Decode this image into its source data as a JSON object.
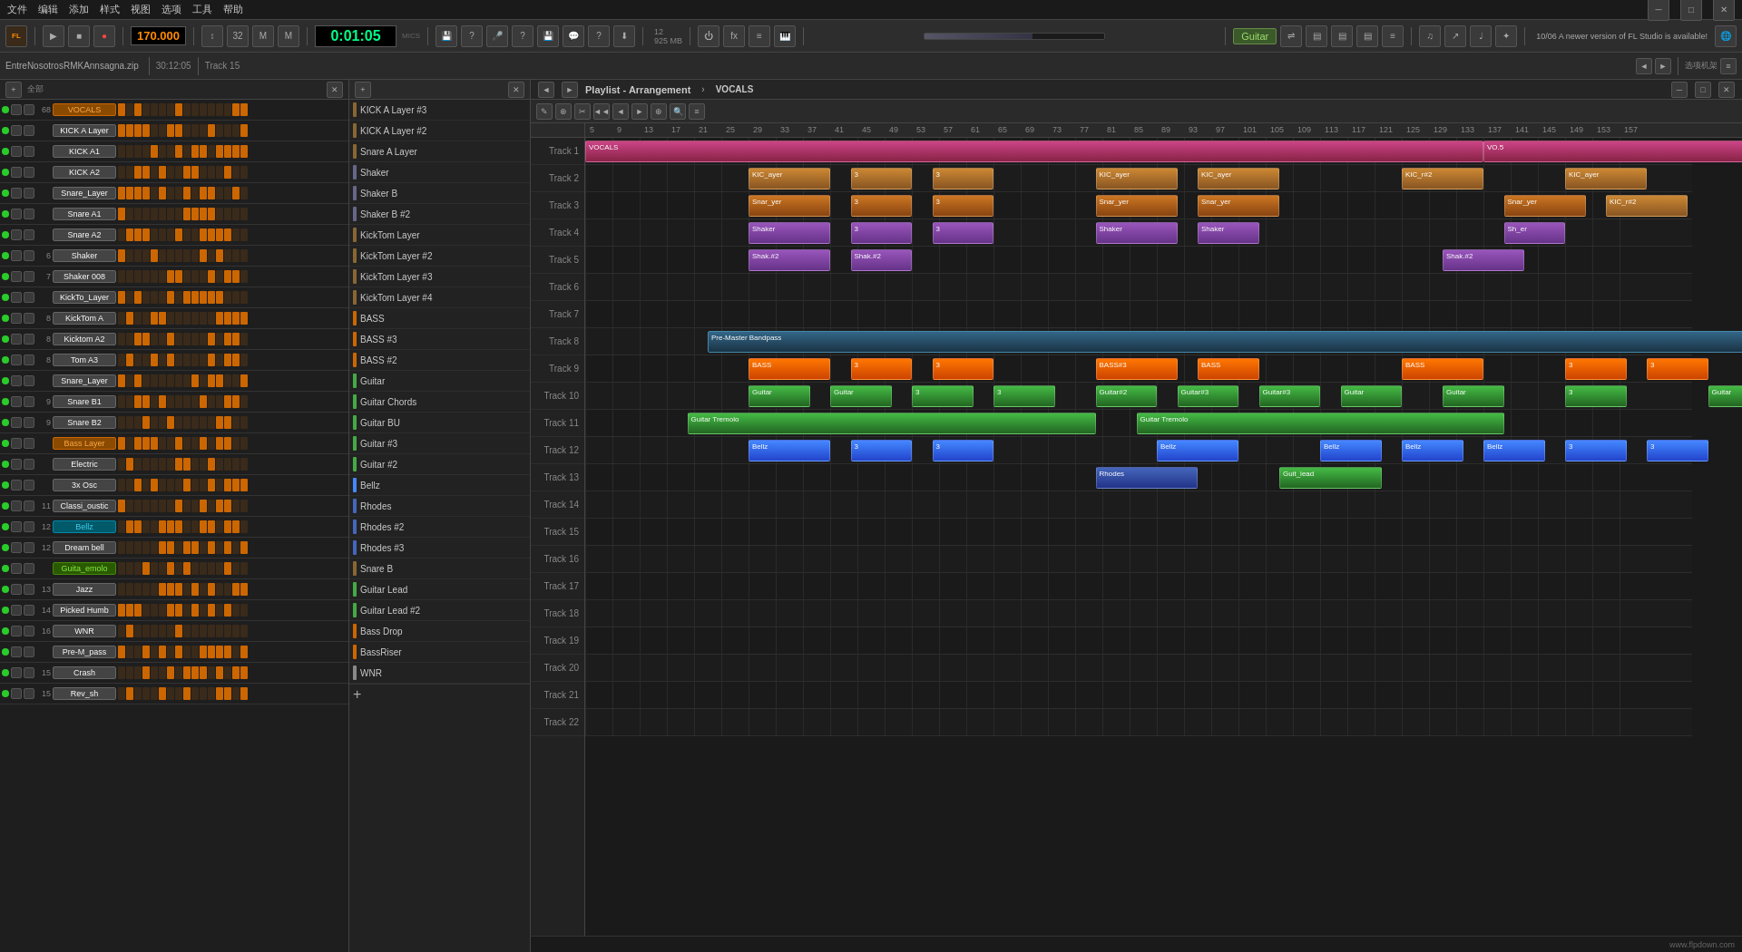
{
  "app": {
    "title": "FL Studio",
    "version_notice": "10/06 A newer version of FL Studio is available!",
    "watermark": "www.flpdown.com"
  },
  "menu": {
    "items": [
      "文件",
      "编辑",
      "添加",
      "样式",
      "视图",
      "选项",
      "工具",
      "帮助"
    ]
  },
  "toolbar": {
    "tempo": "170.000",
    "time": "0:01:05",
    "time_label": "MICS",
    "file_info": "EntreNosotrosRMKAnnsagna.zip",
    "clock": "30:12:05",
    "track_num": "Track 15",
    "guitar_label": "Guitar"
  },
  "left_panel": {
    "tracks": [
      {
        "num": "68",
        "name": "VOCALS",
        "color": "orange",
        "led": "green"
      },
      {
        "num": "",
        "name": "KICK A Layer",
        "color": "default",
        "led": "green"
      },
      {
        "num": "",
        "name": "KICK A1",
        "color": "default",
        "led": "green"
      },
      {
        "num": "",
        "name": "KICK A2",
        "color": "default",
        "led": "green"
      },
      {
        "num": "",
        "name": "Snare_Layer",
        "color": "default",
        "led": "green"
      },
      {
        "num": "",
        "name": "Snare A1",
        "color": "default",
        "led": "green"
      },
      {
        "num": "",
        "name": "Snare A2",
        "color": "default",
        "led": "green"
      },
      {
        "num": "6",
        "name": "Shaker",
        "color": "default",
        "led": "green"
      },
      {
        "num": "7",
        "name": "Shaker 008",
        "color": "default",
        "led": "green"
      },
      {
        "num": "",
        "name": "KickTo_Layer",
        "color": "default",
        "led": "green"
      },
      {
        "num": "8",
        "name": "KickTom A",
        "color": "default",
        "led": "green"
      },
      {
        "num": "8",
        "name": "Kicktom A2",
        "color": "default",
        "led": "green"
      },
      {
        "num": "8",
        "name": "Tom A3",
        "color": "default",
        "led": "green"
      },
      {
        "num": "",
        "name": "Snare_Layer",
        "color": "default",
        "led": "green"
      },
      {
        "num": "9",
        "name": "Snare B1",
        "color": "default",
        "led": "green"
      },
      {
        "num": "9",
        "name": "Snare B2",
        "color": "default",
        "led": "green"
      },
      {
        "num": "",
        "name": "Bass Layer",
        "color": "orange",
        "led": "green"
      },
      {
        "num": "",
        "name": "Electric",
        "color": "default",
        "led": "green"
      },
      {
        "num": "",
        "name": "3x Osc",
        "color": "default",
        "led": "green"
      },
      {
        "num": "11",
        "name": "Classi_oustic",
        "color": "default",
        "led": "green"
      },
      {
        "num": "12",
        "name": "Bellz",
        "color": "cyan",
        "led": "green"
      },
      {
        "num": "12",
        "name": "Dream bell",
        "color": "default",
        "led": "green"
      },
      {
        "num": "",
        "name": "Guita_emolo",
        "color": "green",
        "led": "green"
      },
      {
        "num": "13",
        "name": "Jazz",
        "color": "default",
        "led": "green"
      },
      {
        "num": "14",
        "name": "Picked Humb",
        "color": "default",
        "led": "green"
      },
      {
        "num": "16",
        "name": "WNR",
        "color": "default",
        "led": "green"
      },
      {
        "num": "",
        "name": "Pre-M_pass",
        "color": "default",
        "led": "green"
      },
      {
        "num": "15",
        "name": "Crash",
        "color": "default",
        "led": "green"
      },
      {
        "num": "15",
        "name": "Rev_sh",
        "color": "default",
        "led": "green"
      }
    ]
  },
  "instrument_list": {
    "items": [
      {
        "name": "KICK A Layer #3",
        "color": "#886633"
      },
      {
        "name": "KICK A Layer #2",
        "color": "#886633"
      },
      {
        "name": "Snare A Layer",
        "color": "#886633"
      },
      {
        "name": "Shaker",
        "color": "#666688"
      },
      {
        "name": "Shaker B",
        "color": "#666688"
      },
      {
        "name": "Shaker B #2",
        "color": "#666688"
      },
      {
        "name": "KickTom Layer",
        "color": "#886633"
      },
      {
        "name": "KickTom Layer #2",
        "color": "#886633"
      },
      {
        "name": "KickTom Layer #3",
        "color": "#886633"
      },
      {
        "name": "KickTom Layer #4",
        "color": "#886633"
      },
      {
        "name": "BASS",
        "color": "#cc6600"
      },
      {
        "name": "BASS #3",
        "color": "#cc6600"
      },
      {
        "name": "BASS #2",
        "color": "#cc6600"
      },
      {
        "name": "Guitar",
        "color": "#44aa44"
      },
      {
        "name": "Guitar Chords",
        "color": "#44aa44"
      },
      {
        "name": "Guitar BU",
        "color": "#44aa44"
      },
      {
        "name": "Guitar #3",
        "color": "#44aa44"
      },
      {
        "name": "Guitar #2",
        "color": "#44aa44"
      },
      {
        "name": "Bellz",
        "color": "#4488ff"
      },
      {
        "name": "Rhodes",
        "color": "#4466bb"
      },
      {
        "name": "Rhodes #2",
        "color": "#4466bb"
      },
      {
        "name": "Rhodes #3",
        "color": "#4466bb"
      },
      {
        "name": "Snare B",
        "color": "#886633"
      },
      {
        "name": "Guitar Lead",
        "color": "#44aa44"
      },
      {
        "name": "Guitar Lead #2",
        "color": "#44aa44"
      },
      {
        "name": "Bass Drop",
        "color": "#cc6600"
      },
      {
        "name": "BassRiser",
        "color": "#cc6600"
      },
      {
        "name": "WNR",
        "color": "#888888"
      }
    ]
  },
  "playlist": {
    "title": "Playlist - Arrangement",
    "section": "VOCALS",
    "tracks": [
      "Track 1",
      "Track 2",
      "Track 3",
      "Track 4",
      "Track 5",
      "Track 6",
      "Track 7",
      "Track 8",
      "Track 9",
      "Track 10",
      "Track 11",
      "Track 12",
      "Track 13",
      "Track 14",
      "Track 15",
      "Track 16",
      "Track 17",
      "Track 18",
      "Track 19",
      "Track 20",
      "Track 21",
      "Track 22"
    ],
    "ruler_marks": [
      "5",
      "9",
      "13",
      "17",
      "21",
      "25",
      "29",
      "33",
      "37",
      "41",
      "45",
      "49",
      "53",
      "57",
      "61",
      "65",
      "69",
      "73",
      "77",
      "81",
      "85",
      "89",
      "93",
      "97",
      "101",
      "105",
      "109",
      "113",
      "117",
      "121",
      "125",
      "129",
      "133",
      "137",
      "141",
      "145",
      "149",
      "153",
      "157"
    ]
  }
}
